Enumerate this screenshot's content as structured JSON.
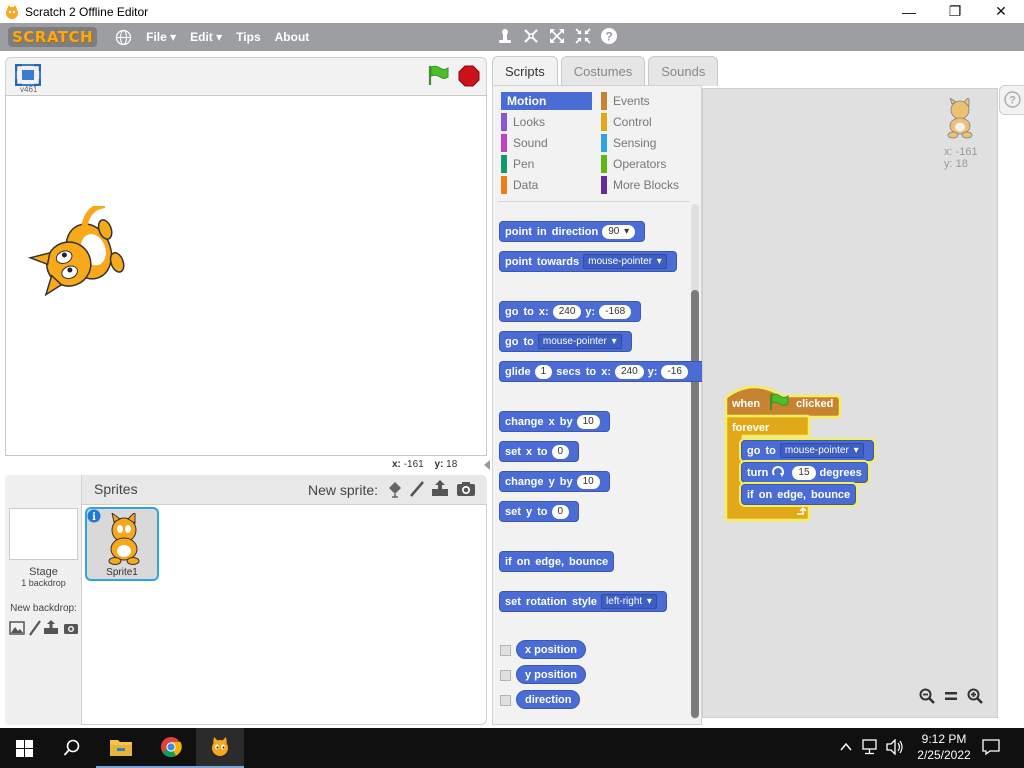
{
  "window": {
    "title": "Scratch 2 Offline Editor",
    "minimize": "—",
    "maximize": "❐",
    "close": "✕"
  },
  "menubar": {
    "logo": "SCRATCH",
    "items": [
      {
        "label": "File",
        "has_arrow": true
      },
      {
        "label": "Edit",
        "has_arrow": true
      },
      {
        "label": "Tips",
        "has_arrow": false
      },
      {
        "label": "About",
        "has_arrow": false
      }
    ],
    "tools": [
      "duplicate-icon",
      "cut-icon",
      "grow-icon",
      "shrink-icon",
      "help-icon"
    ]
  },
  "stage": {
    "version": "v461",
    "mouse_x_label": "x:",
    "mouse_x": "-161",
    "mouse_y_label": "y:",
    "mouse_y": "18"
  },
  "sprites_pane": {
    "title": "Sprites",
    "new_sprite_label": "New sprite:",
    "stage_label": "Stage",
    "stage_sub": "1 backdrop",
    "new_backdrop_label": "New backdrop:",
    "sprites": [
      {
        "name": "Sprite1",
        "selected": true
      }
    ]
  },
  "tabs": [
    {
      "label": "Scripts",
      "active": true
    },
    {
      "label": "Costumes",
      "active": false
    },
    {
      "label": "Sounds",
      "active": false
    }
  ],
  "categories": [
    {
      "label": "Motion",
      "color": "#4a6cd4",
      "active": true
    },
    {
      "label": "Looks",
      "color": "#8a55d7",
      "active": false
    },
    {
      "label": "Sound",
      "color": "#bb42c3",
      "active": false
    },
    {
      "label": "Pen",
      "color": "#0e9a6c",
      "active": false
    },
    {
      "label": "Data",
      "color": "#ee7d16",
      "active": false
    },
    {
      "label": "Events",
      "color": "#c88330",
      "active": false
    },
    {
      "label": "Control",
      "color": "#e1a91a",
      "active": false
    },
    {
      "label": "Sensing",
      "color": "#2ca5e2",
      "active": false
    },
    {
      "label": "Operators",
      "color": "#5cb712",
      "active": false
    },
    {
      "label": "More Blocks",
      "color": "#632d99",
      "active": false
    }
  ],
  "blocks": {
    "point_in_direction": {
      "text": "point in direction",
      "value": "90"
    },
    "point_towards": {
      "text": "point towards",
      "value": "mouse-pointer"
    },
    "go_to_xy": {
      "text1": "go to x:",
      "x": "240",
      "text2": "y:",
      "y": "-168"
    },
    "go_to": {
      "text": "go to",
      "value": "mouse-pointer"
    },
    "glide": {
      "text1": "glide",
      "secs": "1",
      "text2": "secs to x:",
      "x": "240",
      "text3": "y:",
      "y": "-16"
    },
    "change_x": {
      "text": "change x by",
      "value": "10"
    },
    "set_x": {
      "text": "set x to",
      "value": "0"
    },
    "change_y": {
      "text": "change y by",
      "value": "10"
    },
    "set_y": {
      "text": "set y to",
      "value": "0"
    },
    "bounce": {
      "text": "if on edge, bounce"
    },
    "rotation_style": {
      "text": "set rotation style",
      "value": "left-right"
    },
    "reporters": [
      "x position",
      "y position",
      "direction"
    ]
  },
  "script": {
    "hat_when": "when",
    "hat_clicked": "clicked",
    "forever": "forever",
    "goto_text": "go to",
    "goto_value": "mouse-pointer",
    "turn_text": "turn",
    "turn_value": "15",
    "turn_unit": "degrees",
    "bounce": "if on edge, bounce"
  },
  "sprite_info": {
    "x_label": "x:",
    "x": "-161",
    "y_label": "y:",
    "y": "18"
  },
  "taskbar": {
    "time": "9:12 PM",
    "date": "2/25/2022"
  }
}
